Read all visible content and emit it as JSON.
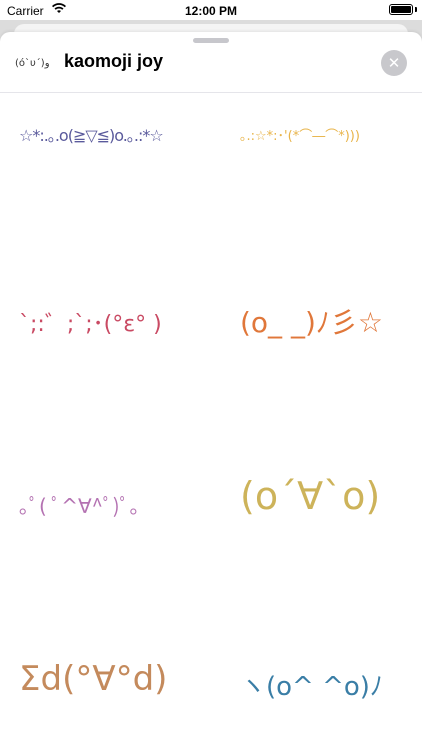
{
  "status_bar": {
    "carrier": "Carrier",
    "time": "12:00 PM",
    "battery_level": 1.0
  },
  "header": {
    "icon_text": "(ó`υ´)و",
    "title": "kaomoji joy",
    "close_icon": "✕"
  },
  "stickers": [
    {
      "text": "☆*:.｡.o(≧▽≦)o.｡.:*☆",
      "color": "#5a5a9c"
    },
    {
      "text": "｡.:☆*:･'(*⌒―⌒*)))",
      "color": "#e8b44a"
    },
    {
      "text": "`;:゛;`;･(°ε° )",
      "color": "#c94a63"
    },
    {
      "text": "(o_ _)ﾉ彡☆",
      "color": "#e0773a"
    },
    {
      "text": "｡ﾟ( ﾟ^∀^ﾟ)ﾟ｡",
      "color": "#b472b2"
    },
    {
      "text": "(o´∀`o)",
      "color": "#cdb35a"
    },
    {
      "text": "Σd(°∀°d)",
      "color": "#c48a5c"
    },
    {
      "text": "ヽ(o^ ^o)ﾉ",
      "color": "#3a7ea6"
    }
  ]
}
